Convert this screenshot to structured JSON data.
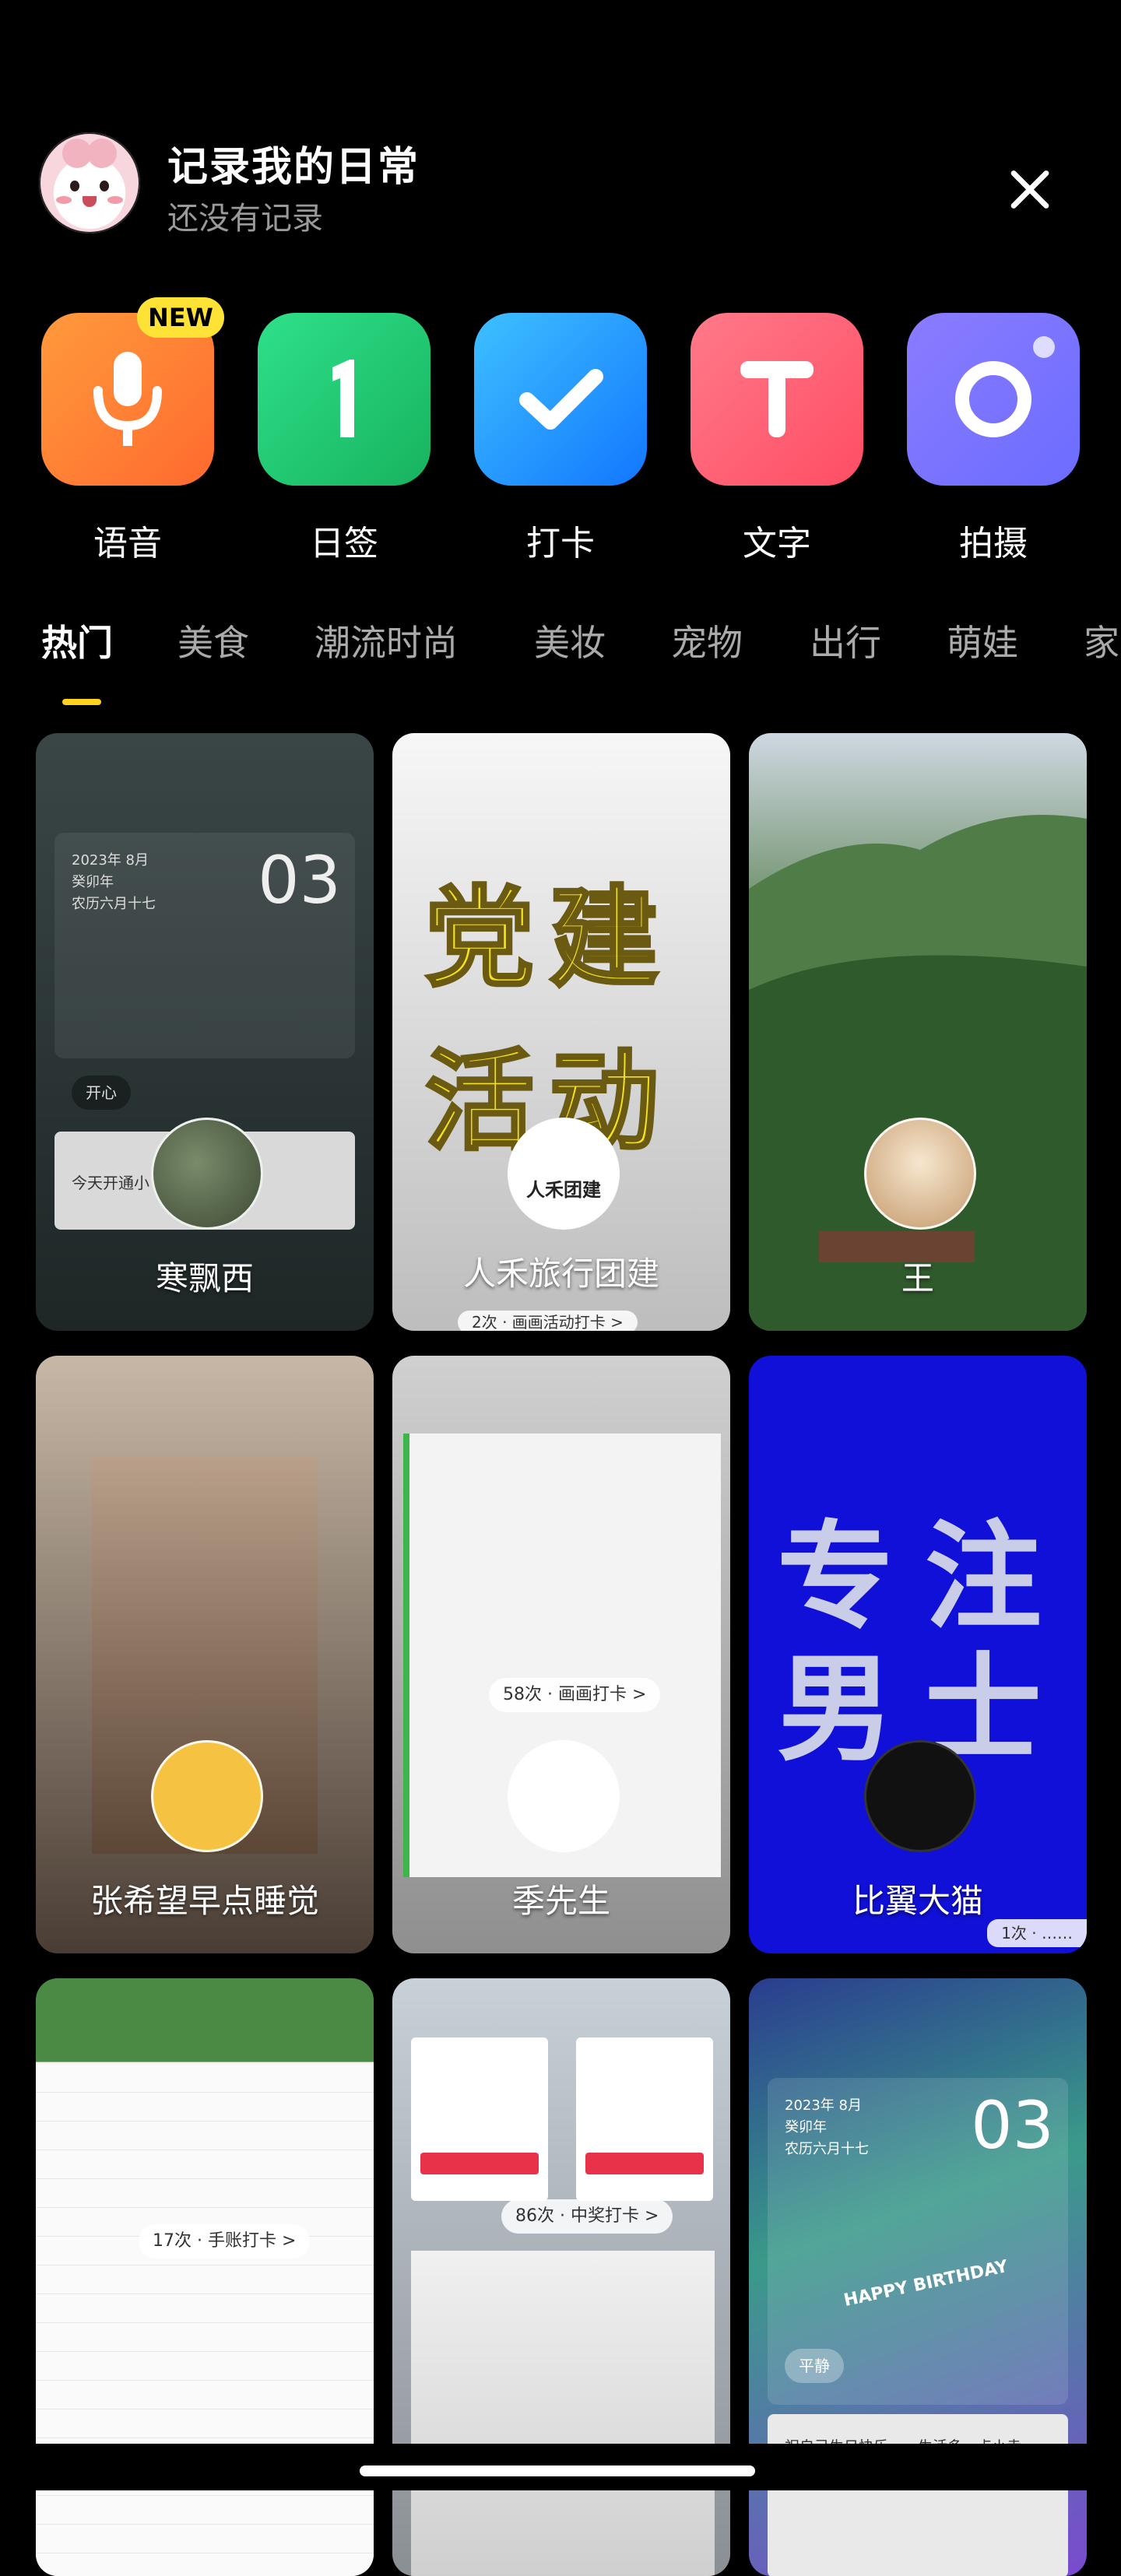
{
  "header": {
    "title": "记录我的日常",
    "subtitle": "还没有记录"
  },
  "actions": [
    {
      "label": "语音",
      "icon": "microphone-icon",
      "colors": [
        "#ff9a3c",
        "#ff6a2e"
      ]
    },
    {
      "label": "日签",
      "icon": "daily-sign-icon",
      "colors": [
        "#2fe08a",
        "#17b35f"
      ]
    },
    {
      "label": "打卡",
      "icon": "checkmark-icon",
      "colors": [
        "#3ec0ff",
        "#1277ff"
      ]
    },
    {
      "label": "文字",
      "icon": "text-icon",
      "colors": [
        "#ff7a8a",
        "#ff4d64"
      ]
    },
    {
      "label": "拍摄",
      "icon": "camera-circle-icon",
      "colors": [
        "#8b7cff",
        "#6b6cff"
      ]
    }
  ],
  "badge": {
    "new": "NEW"
  },
  "tabs": [
    "热门",
    "美食",
    "潮流时尚",
    "美妆",
    "宠物",
    "出行",
    "萌娃",
    "家"
  ],
  "cards": [
    {
      "creator": "寒飘西",
      "date": "2023年 8月\n癸卯年\n农历六月十七",
      "day": "03",
      "mood": "开心",
      "note": "今天开通小"
    },
    {
      "creator": "人禾旅行团建",
      "big_text": "党建活动",
      "logo_text": "人禾团建",
      "pill": "2次 · 画画活动打卡 >"
    },
    {
      "creator": "王"
    },
    {
      "creator": "张希望早点睡觉"
    },
    {
      "creator": "季先生",
      "pill": "58次 · 画画打卡 >"
    },
    {
      "creator": "比翼大猫",
      "big_text_line1": "专注",
      "big_text_line2": "男士",
      "pill": "1次 · ……"
    },
    {
      "creator": "",
      "pill": "17次 · 手账打卡 >"
    },
    {
      "creator": "",
      "pill": "86次 · 中奖打卡 >"
    },
    {
      "creator": "",
      "date": "2023年 8月\n癸卯年\n农历六月十七",
      "day": "03",
      "banner": "HAPPY BIRTHDAY",
      "mood": "平静",
      "note": "祝自己生日快乐……生活多一点小幸运，未来"
    }
  ]
}
